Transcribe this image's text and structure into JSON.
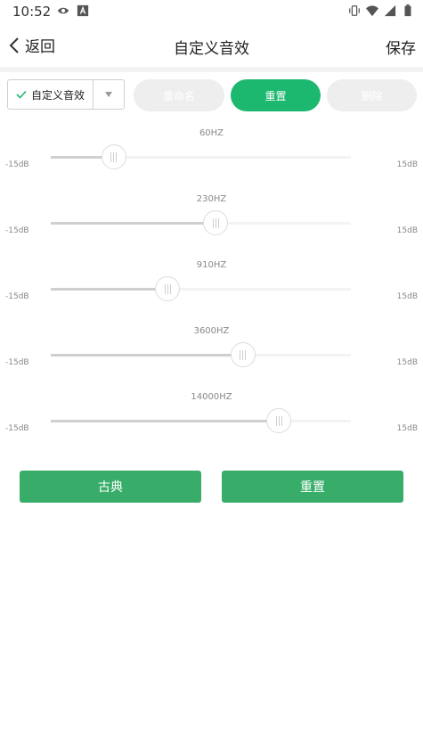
{
  "status_bar": {
    "time": "10:52",
    "left_icons": [
      "eye-icon",
      "text-icon"
    ],
    "right_icons": [
      "vibrate-icon",
      "wifi-icon",
      "signal-icon",
      "battery-icon"
    ]
  },
  "header": {
    "back_label": "返回",
    "title": "自定义音效",
    "save_label": "保存"
  },
  "toolbar": {
    "preset_selected": "自定义音效",
    "rename_label": "重命名",
    "reset_label": "重置",
    "delete_label": "删除"
  },
  "colors": {
    "accent": "#1db870",
    "button_green": "#37ad69",
    "pill_disabled": "#eeeeee"
  },
  "bands": [
    {
      "freq": "60HZ",
      "min": "-15dB",
      "max": "15dB",
      "level": 0.21
    },
    {
      "freq": "230HZ",
      "min": "-15dB",
      "max": "15dB",
      "level": 0.55
    },
    {
      "freq": "910HZ",
      "min": "-15dB",
      "max": "15dB",
      "level": 0.39
    },
    {
      "freq": "3600HZ",
      "min": "-15dB",
      "max": "15dB",
      "level": 0.64
    },
    {
      "freq": "14000HZ",
      "min": "-15dB",
      "max": "15dB",
      "level": 0.76
    }
  ],
  "actions": {
    "classic_label": "古典",
    "reset_label": "重置"
  }
}
